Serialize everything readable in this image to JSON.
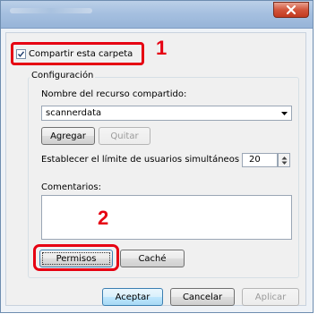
{
  "window": {
    "close_icon": "close-icon",
    "accent_close": "#c23a1f"
  },
  "share": {
    "checkbox_label": "Compartir esta carpeta",
    "checked": true
  },
  "callouts": {
    "step1": "1",
    "step2": "2",
    "color": "#e60012"
  },
  "config": {
    "group_label": "Configuración",
    "share_name_label": "Nombre del recurso compartido:",
    "share_name_value": "scannerdata",
    "add_button": "Agregar",
    "remove_button": "Quitar",
    "user_limit_label": "Establecer el límite de usuarios simultáneos en:",
    "user_limit_value": "20",
    "comments_label": "Comentarios:",
    "comments_value": "",
    "permissions_button": "Permisos",
    "cache_button": "Caché"
  },
  "footer": {
    "ok_button": "Aceptar",
    "cancel_button": "Cancelar",
    "apply_button": "Aplicar"
  }
}
